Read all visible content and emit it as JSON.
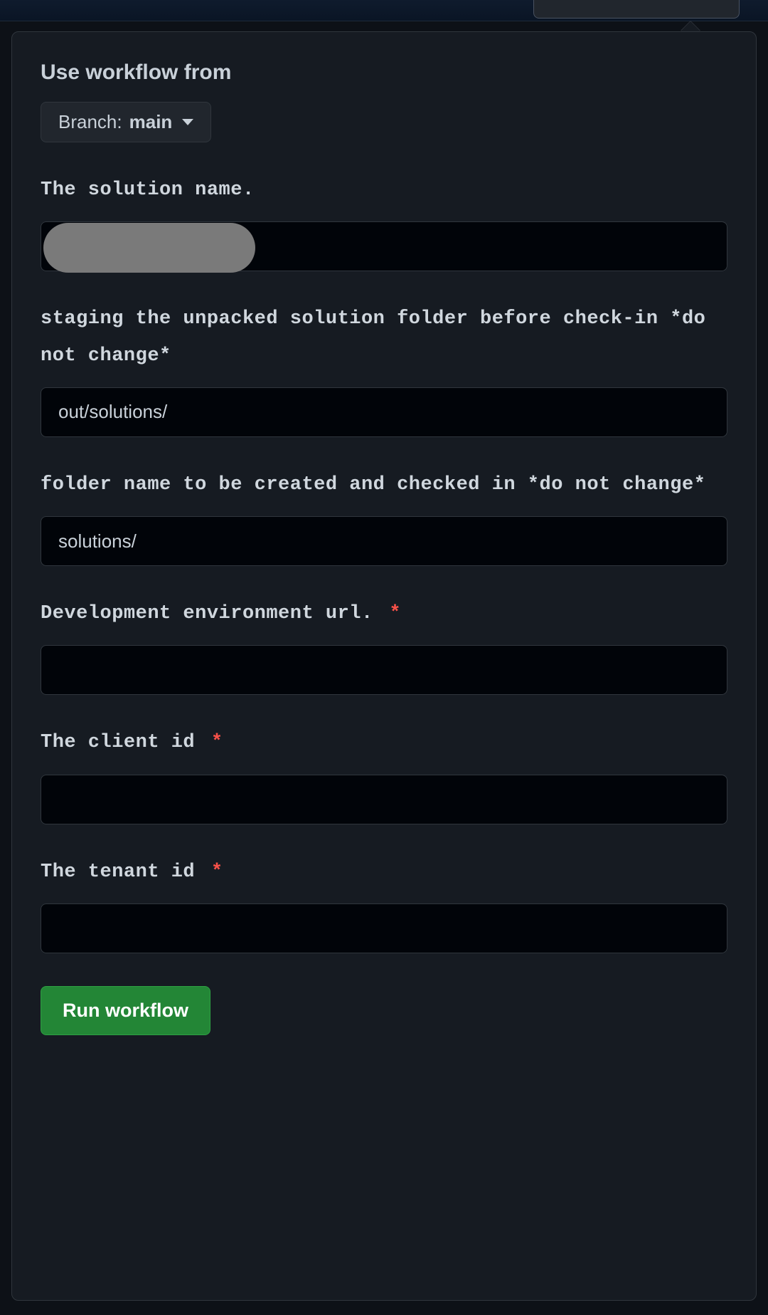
{
  "header": {
    "title": "Use workflow from",
    "branch_prefix": "Branch:",
    "branch_name": "main"
  },
  "fields": {
    "solution_name": {
      "label": "The solution name.",
      "value": "",
      "required": false
    },
    "staging_folder": {
      "label": "staging the unpacked solution folder before check-in *do not change*",
      "value": "out/solutions/",
      "required": false
    },
    "target_folder": {
      "label": "folder name to be created and checked in *do not change*",
      "value": "solutions/",
      "required": false
    },
    "dev_env_url": {
      "label": "Development environment url.",
      "value": "",
      "required": true
    },
    "client_id": {
      "label": "The client id",
      "value": "",
      "required": true
    },
    "tenant_id": {
      "label": "The tenant id",
      "value": "",
      "required": true
    }
  },
  "buttons": {
    "run_workflow": "Run workflow"
  },
  "required_marker": "*"
}
